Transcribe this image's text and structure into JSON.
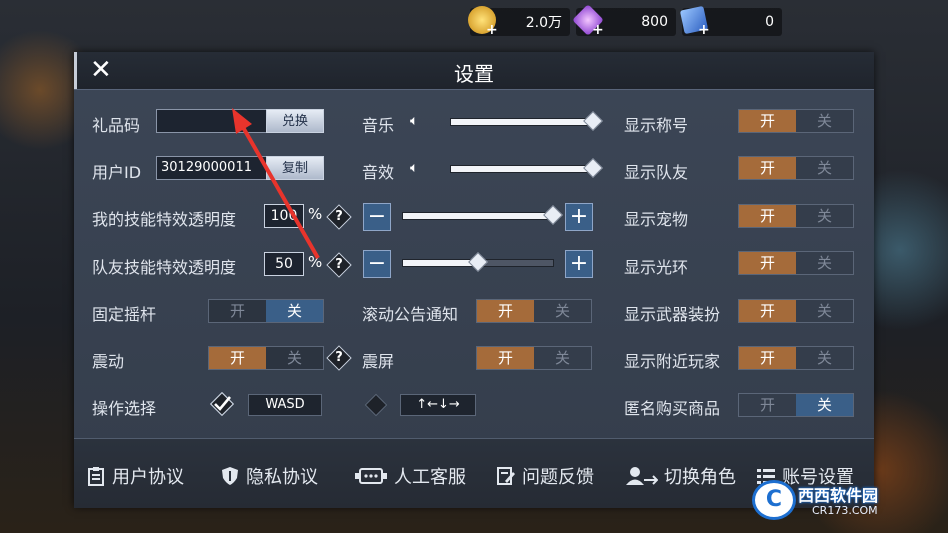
{
  "currency": [
    {
      "icon": "gold-coin-icon",
      "value": "2.0万"
    },
    {
      "icon": "purple-gem-icon",
      "value": "800"
    },
    {
      "icon": "blue-card-icon",
      "value": "0"
    }
  ],
  "dialog": {
    "title": "设置",
    "close_icon": "close-icon"
  },
  "gift_code": {
    "label": "礼品码",
    "value": "",
    "button": "兑换"
  },
  "user_id": {
    "label": "用户ID",
    "value": "30129000011",
    "button": "复制"
  },
  "my_skill_opacity": {
    "label": "我的技能特效透明度",
    "value": "100",
    "unit": "%",
    "help": "?"
  },
  "team_skill_opacity": {
    "label": "队友技能特效透明度",
    "value": "50",
    "unit": "%",
    "help": "?"
  },
  "fixed_joystick": {
    "label": "固定摇杆",
    "on": "开",
    "off": "关",
    "state": "off"
  },
  "vibration": {
    "label": "震动",
    "on": "开",
    "off": "关",
    "state": "on",
    "help": "?"
  },
  "control": {
    "label": "操作选择",
    "option1": "WASD",
    "option2": "↑←↓→",
    "selected": "WASD"
  },
  "music": {
    "label": "音乐",
    "level": 1.0
  },
  "sfx": {
    "label": "音效",
    "level": 1.0
  },
  "my_opacity_slider": {
    "level": 1.0,
    "minus": "−",
    "plus": "+"
  },
  "team_opacity_slider": {
    "level": 0.5,
    "minus": "−",
    "plus": "+"
  },
  "scroll_notice": {
    "label": "滚动公告通知",
    "on": "开",
    "off": "关",
    "state": "on"
  },
  "screen_shake": {
    "label": "震屏",
    "on": "开",
    "off": "关",
    "state": "on"
  },
  "right_toggles": [
    {
      "label": "显示称号",
      "on": "开",
      "off": "关",
      "state": "on"
    },
    {
      "label": "显示队友",
      "on": "开",
      "off": "关",
      "state": "on"
    },
    {
      "label": "显示宠物",
      "on": "开",
      "off": "关",
      "state": "on"
    },
    {
      "label": "显示光环",
      "on": "开",
      "off": "关",
      "state": "on"
    },
    {
      "label": "显示武器装扮",
      "on": "开",
      "off": "关",
      "state": "on"
    },
    {
      "label": "显示附近玩家",
      "on": "开",
      "off": "关",
      "state": "on"
    },
    {
      "label": "匿名购买商品",
      "on": "开",
      "off": "关",
      "state": "off"
    }
  ],
  "bottom": [
    {
      "label": "用户协议",
      "icon": "clipboard-icon"
    },
    {
      "label": "隐私协议",
      "icon": "shield-icon"
    },
    {
      "label": "人工客服",
      "icon": "customer-service-icon"
    },
    {
      "label": "问题反馈",
      "icon": "feedback-icon"
    },
    {
      "label": "切换角色",
      "icon": "switch-user-icon"
    },
    {
      "label": "账号设置",
      "icon": "list-icon"
    }
  ],
  "watermark": {
    "logo": "C",
    "text": "西西软件园",
    "url": "CR173.COM"
  }
}
